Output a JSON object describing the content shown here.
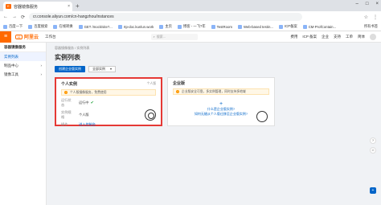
{
  "browser": {
    "tab_title": "容器镜像服务",
    "tab_favicon": "E",
    "tab_close": "×",
    "new_tab": "+",
    "window_controls": [
      "–",
      "□",
      "×"
    ],
    "nav_buttons": [
      "←",
      "→",
      "⟳"
    ],
    "url": "cr.console.aliyun.com/cn-hangzhou/instances",
    "right_icons": [
      "☆",
      "⋮"
    ]
  },
  "bookmarks": [
    "百度一下",
    "百度搜索",
    "在线转换",
    "GET /mock/site?...",
    "rtp-doc.kunlun.work",
    "主页",
    "博客 - 一飞?年",
    "TestRoom",
    "Web-based testin...",
    "ICP备案",
    "CM-ProfContain..."
  ],
  "bookmarks_right": "所有书签",
  "console_nav": {
    "menu_icon": "≡",
    "logo_mark": "[-]",
    "logo_text": "阿里云",
    "workspace": "工作台",
    "search_placeholder": "搜索...",
    "right_items": [
      "费用",
      "ICP 备案",
      "企业",
      "支持",
      "工单"
    ],
    "lang": "简体"
  },
  "sidebar": {
    "title": "容器镜像服务",
    "items": [
      {
        "label": "实例列表",
        "active": true,
        "arrow": ""
      },
      {
        "label": "制品中心",
        "active": false,
        "arrow": "›"
      },
      {
        "label": "镜像工具",
        "active": false,
        "arrow": "›"
      }
    ]
  },
  "main": {
    "breadcrumb": "容器镜像服务 / 实例列表",
    "title": "实例列表",
    "create_button": "创建企业版实例",
    "filter_select": "全部实例",
    "filter_arrow": "▾"
  },
  "personal_card": {
    "title": "个人实例",
    "tag": "个人版",
    "notice": "个人版镜像服务，免费使用",
    "fields": [
      {
        "key": "运行状态",
        "value": "运行中",
        "status": true
      },
      {
        "key": "实例规格",
        "value": "个人版"
      },
      {
        "key": "操作",
        "value": "进入控制台",
        "link": true
      }
    ]
  },
  "enterprise_card": {
    "title": "企业版",
    "notice": "企业版安全可靠，多实例管理，同时支持多地域",
    "plus": "+",
    "link1": "什么是企业版实例?",
    "link2": "如何无缝从个人版迁移至企业版实例?"
  },
  "floaters": [
    "?",
    "☺"
  ],
  "fab": "+",
  "colors": {
    "accent": "#ff6a00",
    "primary": "#0064c8",
    "highlight": "#e53935",
    "ok": "#22a23b"
  }
}
